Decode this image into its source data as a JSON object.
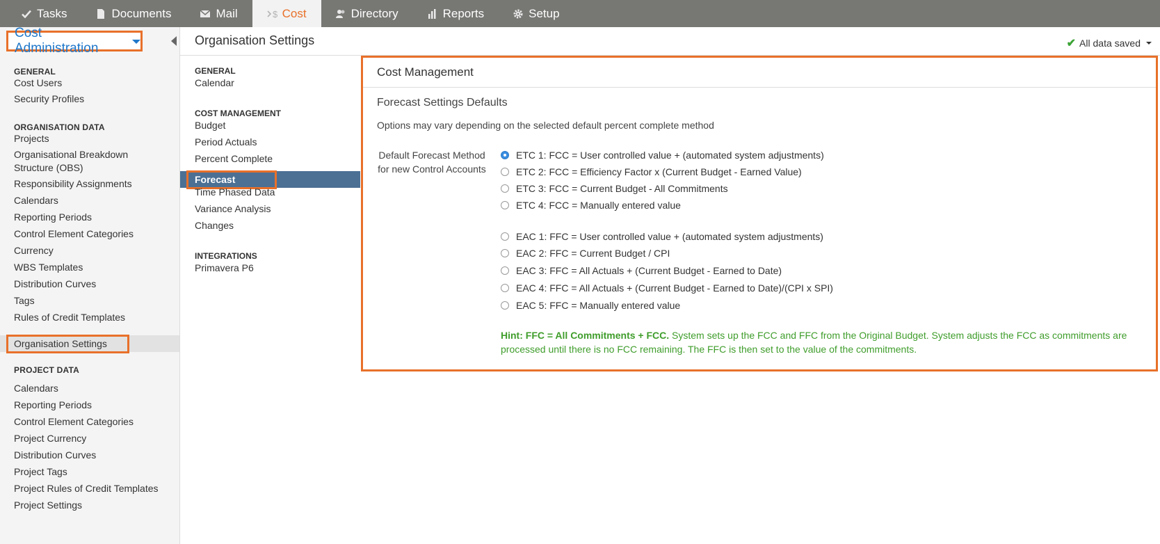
{
  "topnav": {
    "tabs": [
      {
        "label": "Tasks",
        "icon": "check-icon"
      },
      {
        "label": "Documents",
        "icon": "document-icon"
      },
      {
        "label": "Mail",
        "icon": "envelope-icon"
      },
      {
        "label": "Cost",
        "icon": "cost-icon"
      },
      {
        "label": "Directory",
        "icon": "people-icon"
      },
      {
        "label": "Reports",
        "icon": "bar-chart-icon"
      },
      {
        "label": "Setup",
        "icon": "gear-icon"
      }
    ],
    "active": "Cost"
  },
  "sidebar": {
    "module_button": "Cost Administration",
    "sections": [
      {
        "title": "GENERAL",
        "items": [
          "Cost Users",
          "Security Profiles"
        ]
      },
      {
        "title": "ORGANISATION DATA",
        "items": [
          "Projects",
          "Organisational Breakdown",
          "Structure (OBS)",
          "Responsibility Assignments",
          "Calendars",
          "Reporting Periods",
          "Control Element Categories",
          "Currency",
          "WBS Templates",
          "Distribution Curves",
          "Tags",
          "Rules of Credit Templates",
          "Organisation Settings"
        ]
      },
      {
        "title": "PROJECT DATA",
        "items": [
          "Calendars",
          "Reporting Periods",
          "Control Element Categories",
          "Project Currency",
          "Distribution Curves",
          "Project Tags",
          "Project Rules of Credit Templates",
          "Project Settings"
        ]
      }
    ],
    "selected": "Organisation Settings"
  },
  "header": {
    "title": "Organisation Settings",
    "status": "All data saved"
  },
  "midnav": {
    "sections": [
      {
        "title": "GENERAL",
        "items": [
          "Calendar"
        ]
      },
      {
        "title": "COST MANAGEMENT",
        "items": [
          "Budget",
          "Period Actuals",
          "Percent Complete",
          "Forecast",
          "Time Phased Data",
          "Variance Analysis",
          "Changes"
        ]
      },
      {
        "title": "INTEGRATIONS",
        "items": [
          "Primavera P6"
        ]
      }
    ],
    "selected": "Forecast"
  },
  "panel": {
    "title": "Cost Management",
    "subtitle": "Forecast Settings Defaults",
    "description": "Options may vary depending on the selected default percent complete method",
    "field_label_line1": "Default Forecast Method",
    "field_label_line2": "for new Control Accounts",
    "etc_options": [
      "ETC 1: FCC = User controlled value + (automated system adjustments)",
      "ETC 2: FCC = Efficiency Factor x (Current Budget - Earned Value)",
      "ETC 3: FCC = Current Budget - All Commitments",
      "ETC 4: FCC = Manually entered value"
    ],
    "eac_options": [
      "EAC 1: FFC = User controlled value + (automated system adjustments)",
      "EAC 2: FFC = Current Budget / CPI",
      "EAC 3: FFC = All Actuals + (Current Budget - Earned to Date)",
      "EAC 4: FFC = All Actuals + (Current Budget - Earned to Date)/(CPI x SPI)",
      "EAC 5: FFC = Manually entered value"
    ],
    "selected_option": "ETC 1: FCC = User controlled value + (automated system adjustments)",
    "hint_bold": "Hint: FFC = All Commitments + FCC.",
    "hint_text": " System sets up the FCC and FFC from the Original Budget. System adjusts the FCC as commitments are processed until there is no FCC remaining. The FFC is then set to the value of the commitments."
  },
  "colors": {
    "accent": "#e8702a",
    "link_blue": "#1f77c9",
    "nav_bg": "#777774",
    "selected_bar": "#4c7094",
    "hint_green": "#3f9d2b"
  }
}
